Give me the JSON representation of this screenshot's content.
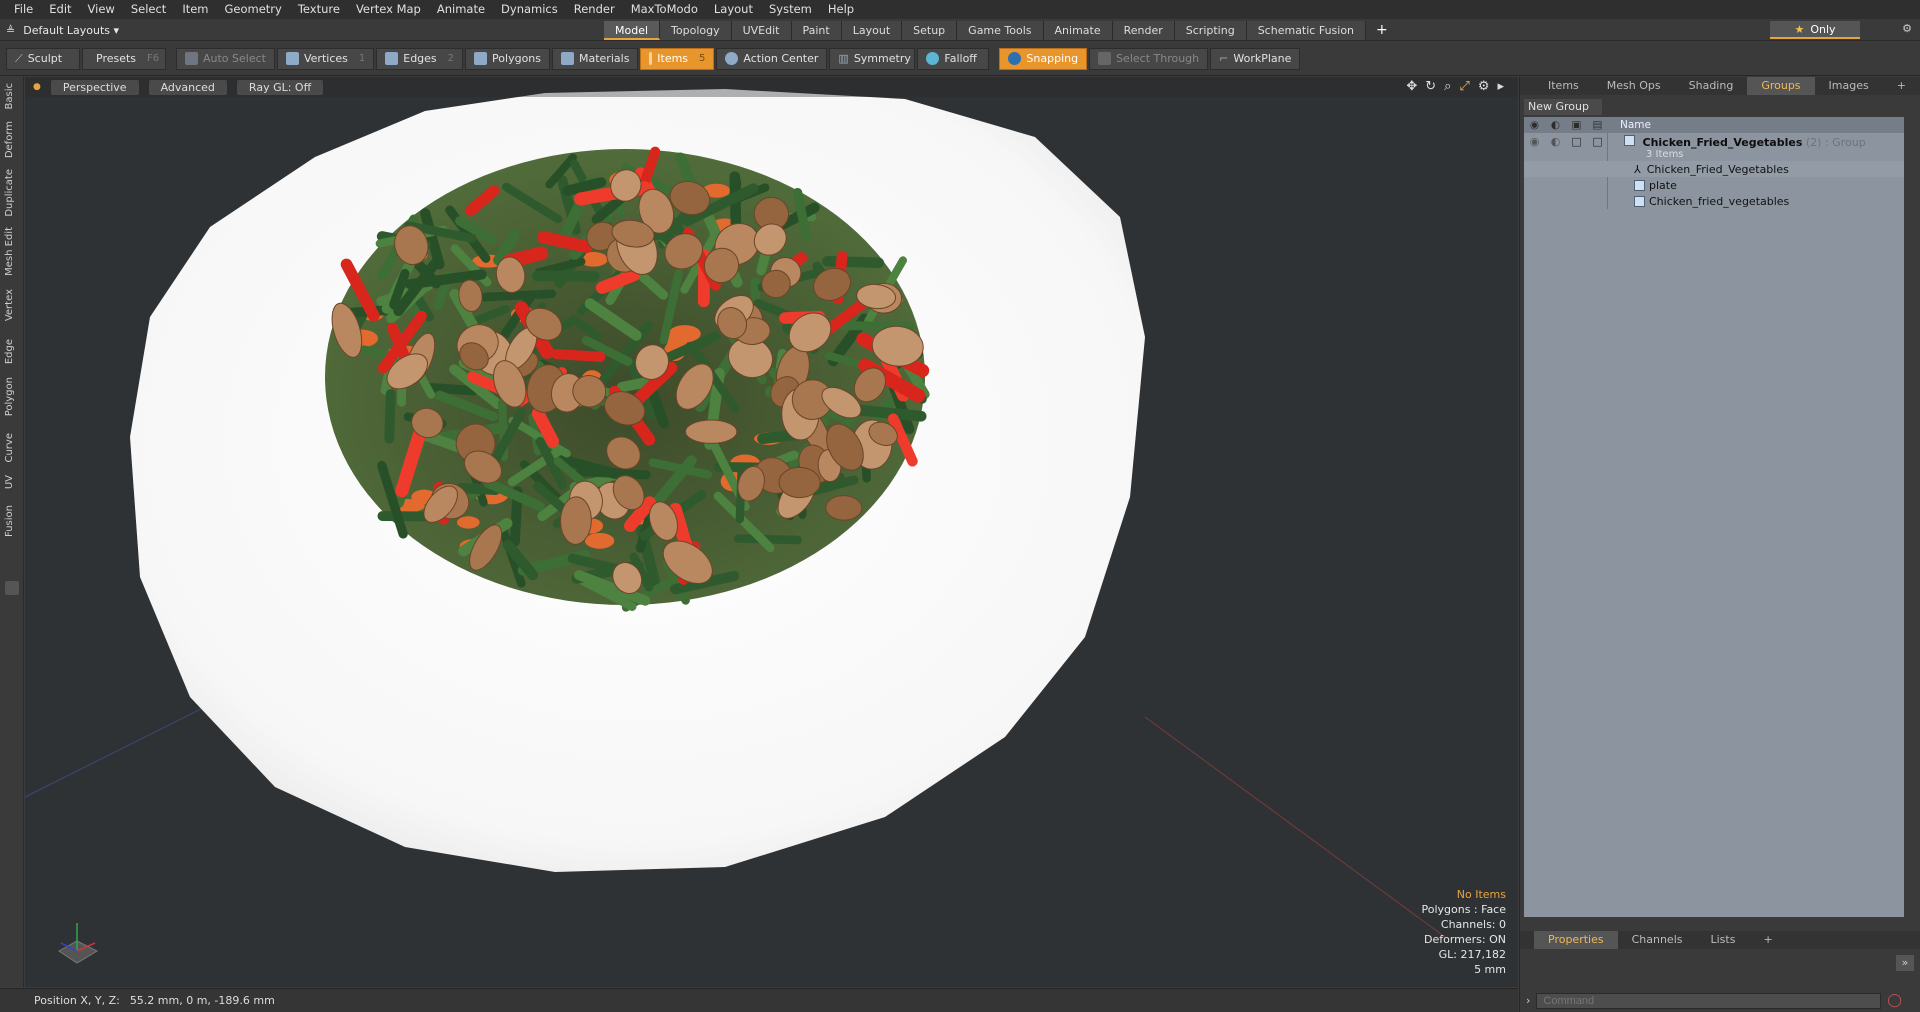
{
  "menu": [
    "File",
    "Edit",
    "View",
    "Select",
    "Item",
    "Geometry",
    "Texture",
    "Vertex Map",
    "Animate",
    "Dynamics",
    "Render",
    "MaxToModo",
    "Layout",
    "System",
    "Help"
  ],
  "layout_selector": "Default Layouts ▾",
  "layout_tabs": [
    {
      "label": "Model",
      "active": true
    },
    {
      "label": "Topology",
      "active": false
    },
    {
      "label": "UVEdit",
      "active": false
    },
    {
      "label": "Paint",
      "active": false
    },
    {
      "label": "Layout",
      "active": false
    },
    {
      "label": "Setup",
      "active": false
    },
    {
      "label": "Game Tools",
      "active": false
    },
    {
      "label": "Animate",
      "active": false
    },
    {
      "label": "Render",
      "active": false
    },
    {
      "label": "Scripting",
      "active": false
    },
    {
      "label": "Schematic Fusion",
      "active": false
    }
  ],
  "only_label": "Only",
  "toolbar": {
    "sculpt": "Sculpt",
    "presets": "Presets",
    "presets_key": "F6",
    "auto_select": "Auto Select",
    "vertices": "Vertices",
    "vertices_count": "1",
    "edges": "Edges",
    "edges_count": "2",
    "polygons": "Polygons",
    "materials": "Materials",
    "items": "Items",
    "items_count": "5",
    "action_center": "Action Center",
    "symmetry": "Symmetry",
    "falloff": "Falloff",
    "snapping": "Snapping",
    "select_through": "Select Through",
    "workplane": "WorkPlane"
  },
  "left_tabs": [
    "Basic",
    "Deform",
    "Duplicate",
    "Mesh Edit",
    "Vertex",
    "Edge",
    "Polygon",
    "Curve",
    "UV",
    "Fusion"
  ],
  "viewport": {
    "perspective": "Perspective",
    "advanced": "Advanced",
    "raygl": "Ray GL: Off",
    "info": {
      "no_items": "No Items",
      "polygons": "Polygons : Face",
      "channels": "Channels: 0",
      "deformers": "Deformers: ON",
      "gl": "GL: 217,182",
      "scale": "5 mm"
    }
  },
  "status": {
    "label": "Position X, Y, Z:",
    "value": "55.2 mm, 0 m, -189.6 mm"
  },
  "right_panel": {
    "tabs": [
      {
        "label": "Items",
        "active": false
      },
      {
        "label": "Mesh Ops",
        "active": false
      },
      {
        "label": "Shading",
        "active": false
      },
      {
        "label": "Groups",
        "active": true
      },
      {
        "label": "Images",
        "active": false
      }
    ],
    "new_group": "New Group",
    "name_header": "Name",
    "group": {
      "name": "Chicken_Fried_Vegetables",
      "count": "(2)",
      "type": ": Group",
      "sub": "3 Items"
    },
    "items": [
      "Chicken_Fried_Vegetables",
      "plate",
      "Chicken_fried_vegetables"
    ],
    "bottom_tabs": [
      {
        "label": "Properties",
        "active": true
      },
      {
        "label": "Channels",
        "active": false
      },
      {
        "label": "Lists",
        "active": false
      }
    ],
    "command_placeholder": "Command"
  },
  "colors": {
    "accent": "#e8952b",
    "viewport_bg": "#2f3235",
    "plate": "#ffffff",
    "tree_bg": "#8c959f"
  }
}
